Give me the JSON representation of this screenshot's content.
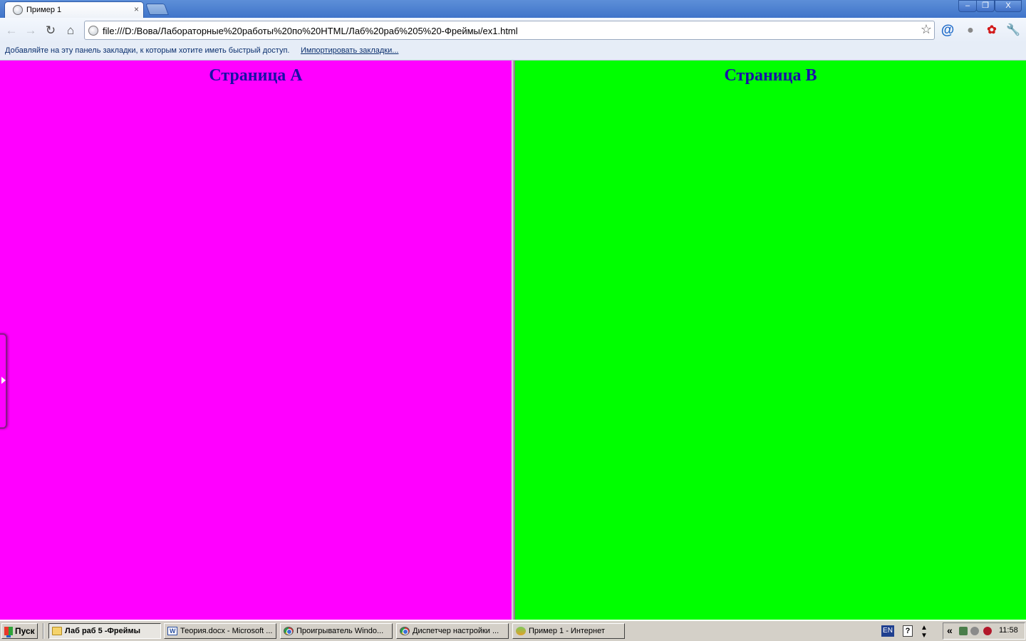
{
  "browser": {
    "tab_title": "Пример 1",
    "tab_close": "×",
    "url": "file:///D:/Вова/Лабораторные%20работы%20по%20HTML/Лаб%20раб%205%20-Фреймы/ex1.html",
    "bookmarks_hint": "Добавляйте на эту панель закладки, к которым хотите иметь быстрый доступ.",
    "import_bookmarks": "Импортировать закладки...",
    "win_min": "–",
    "win_max": "❐",
    "win_close": "X"
  },
  "frames": {
    "left": {
      "heading": "Страница A",
      "color": "#ff00ff"
    },
    "right": {
      "heading": "Страница B",
      "color": "#00ff00"
    }
  },
  "taskbar": {
    "start_label": "Пуск",
    "tasks": [
      {
        "label": "Лаб раб 5 -Фреймы",
        "icon": "folder-icon",
        "active": true
      },
      {
        "label": "Теория.docx - Microsoft ...",
        "icon": "word-icon",
        "active": false
      },
      {
        "label": "Проигрыватель Windo...",
        "icon": "chrome-icon",
        "active": false
      },
      {
        "label": "Диспетчер настройки ...",
        "icon": "chrome-icon",
        "active": false
      },
      {
        "label": "Пример 1 - Интернет",
        "icon": "ie-icon",
        "active": false
      }
    ],
    "lang": "EN",
    "help": "?",
    "chevron": "«",
    "clock": "11:58"
  }
}
